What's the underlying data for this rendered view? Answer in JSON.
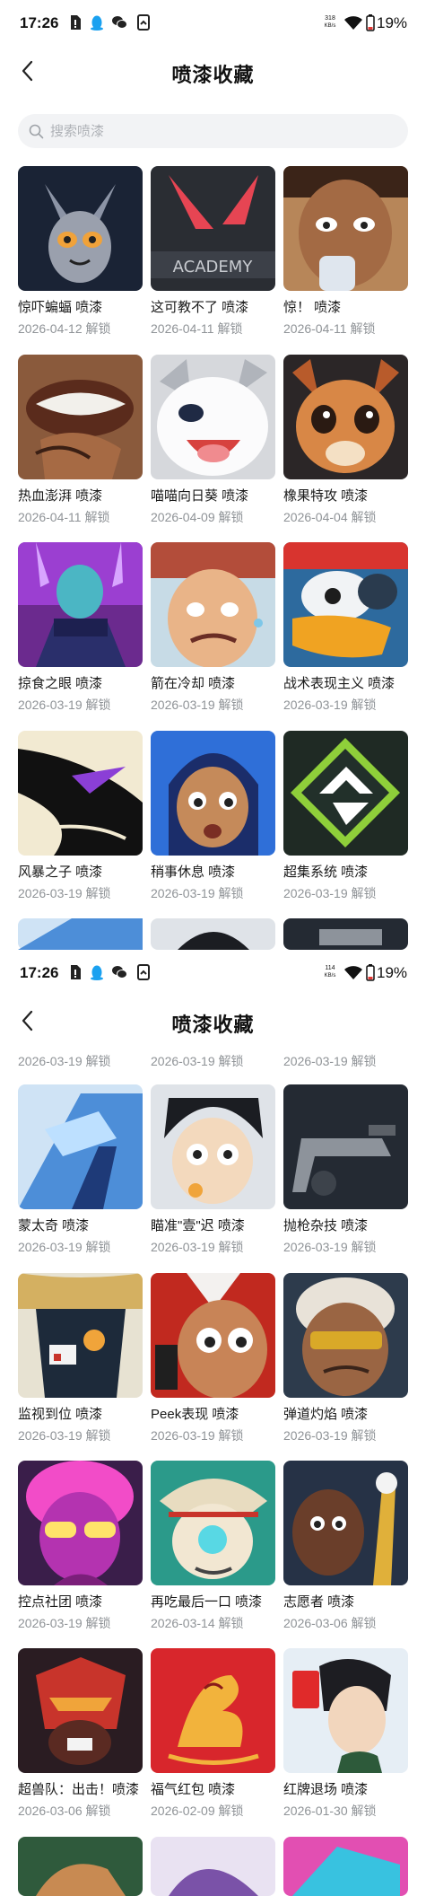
{
  "status_top": {
    "time": "17:26",
    "net_speed": "318",
    "net_unit": "KB/s",
    "battery": "19%"
  },
  "status_bottom": {
    "time": "17:26",
    "net_speed": "114",
    "net_unit": "KB/s",
    "battery": "19%"
  },
  "header": {
    "title": "喷漆收藏",
    "back_icon": "chevron-left-icon"
  },
  "search": {
    "placeholder": "搜索喷漆",
    "value": ""
  },
  "colors": {
    "date_text": "#8f9397",
    "search_bg": "#f2f3f5",
    "battery_low": "#e53935"
  },
  "sprays_top": [
    {
      "name": "惊吓蝙蝠 喷漆",
      "date": "2026-04-12 解锁"
    },
    {
      "name": "这可教不了 喷漆",
      "date": "2026-04-11 解锁"
    },
    {
      "name": "惊！ 喷漆",
      "date": "2026-04-11 解锁"
    },
    {
      "name": "热血澎湃 喷漆",
      "date": "2026-04-11 解锁"
    },
    {
      "name": "喵喵向日葵 喷漆",
      "date": "2026-04-09 解锁"
    },
    {
      "name": "橡果特攻 喷漆",
      "date": "2026-04-04 解锁"
    },
    {
      "name": "掠食之眼 喷漆",
      "date": "2026-03-19 解锁"
    },
    {
      "name": "箭在冷却 喷漆",
      "date": "2026-03-19 解锁"
    },
    {
      "name": "战术表现主义 喷漆",
      "date": "2026-03-19 解锁"
    },
    {
      "name": "风暴之子 喷漆",
      "date": "2026-03-19 解锁"
    },
    {
      "name": "稍事休息 喷漆",
      "date": "2026-03-19 解锁"
    },
    {
      "name": "超集系统 喷漆",
      "date": "2026-03-19 解锁"
    }
  ],
  "sprays_bottom_partial_dates": [
    "2026-03-19 解锁",
    "2026-03-19 解锁",
    "2026-03-19 解锁"
  ],
  "sprays_bottom": [
    {
      "name": "蒙太奇 喷漆",
      "date": "2026-03-19 解锁"
    },
    {
      "name": "瞄准\"壹\"迟 喷漆",
      "date": "2026-03-19 解锁"
    },
    {
      "name": "抛枪杂技 喷漆",
      "date": "2026-03-19 解锁"
    },
    {
      "name": "监视到位 喷漆",
      "date": "2026-03-19 解锁"
    },
    {
      "name": "Peek表现 喷漆",
      "date": "2026-03-19 解锁"
    },
    {
      "name": "弹道灼焰 喷漆",
      "date": "2026-03-19 解锁"
    },
    {
      "name": "控点社团 喷漆",
      "date": "2026-03-19 解锁"
    },
    {
      "name": "再吃最后一口 喷漆",
      "date": "2026-03-14 解锁"
    },
    {
      "name": "志愿者 喷漆",
      "date": "2026-03-06 解锁"
    },
    {
      "name": "超兽队：出击！喷漆",
      "date": "2026-03-06 解锁"
    },
    {
      "name": "福气红包 喷漆",
      "date": "2026-02-09 解锁"
    },
    {
      "name": "红牌退场 喷漆",
      "date": "2026-01-30 解锁"
    }
  ]
}
